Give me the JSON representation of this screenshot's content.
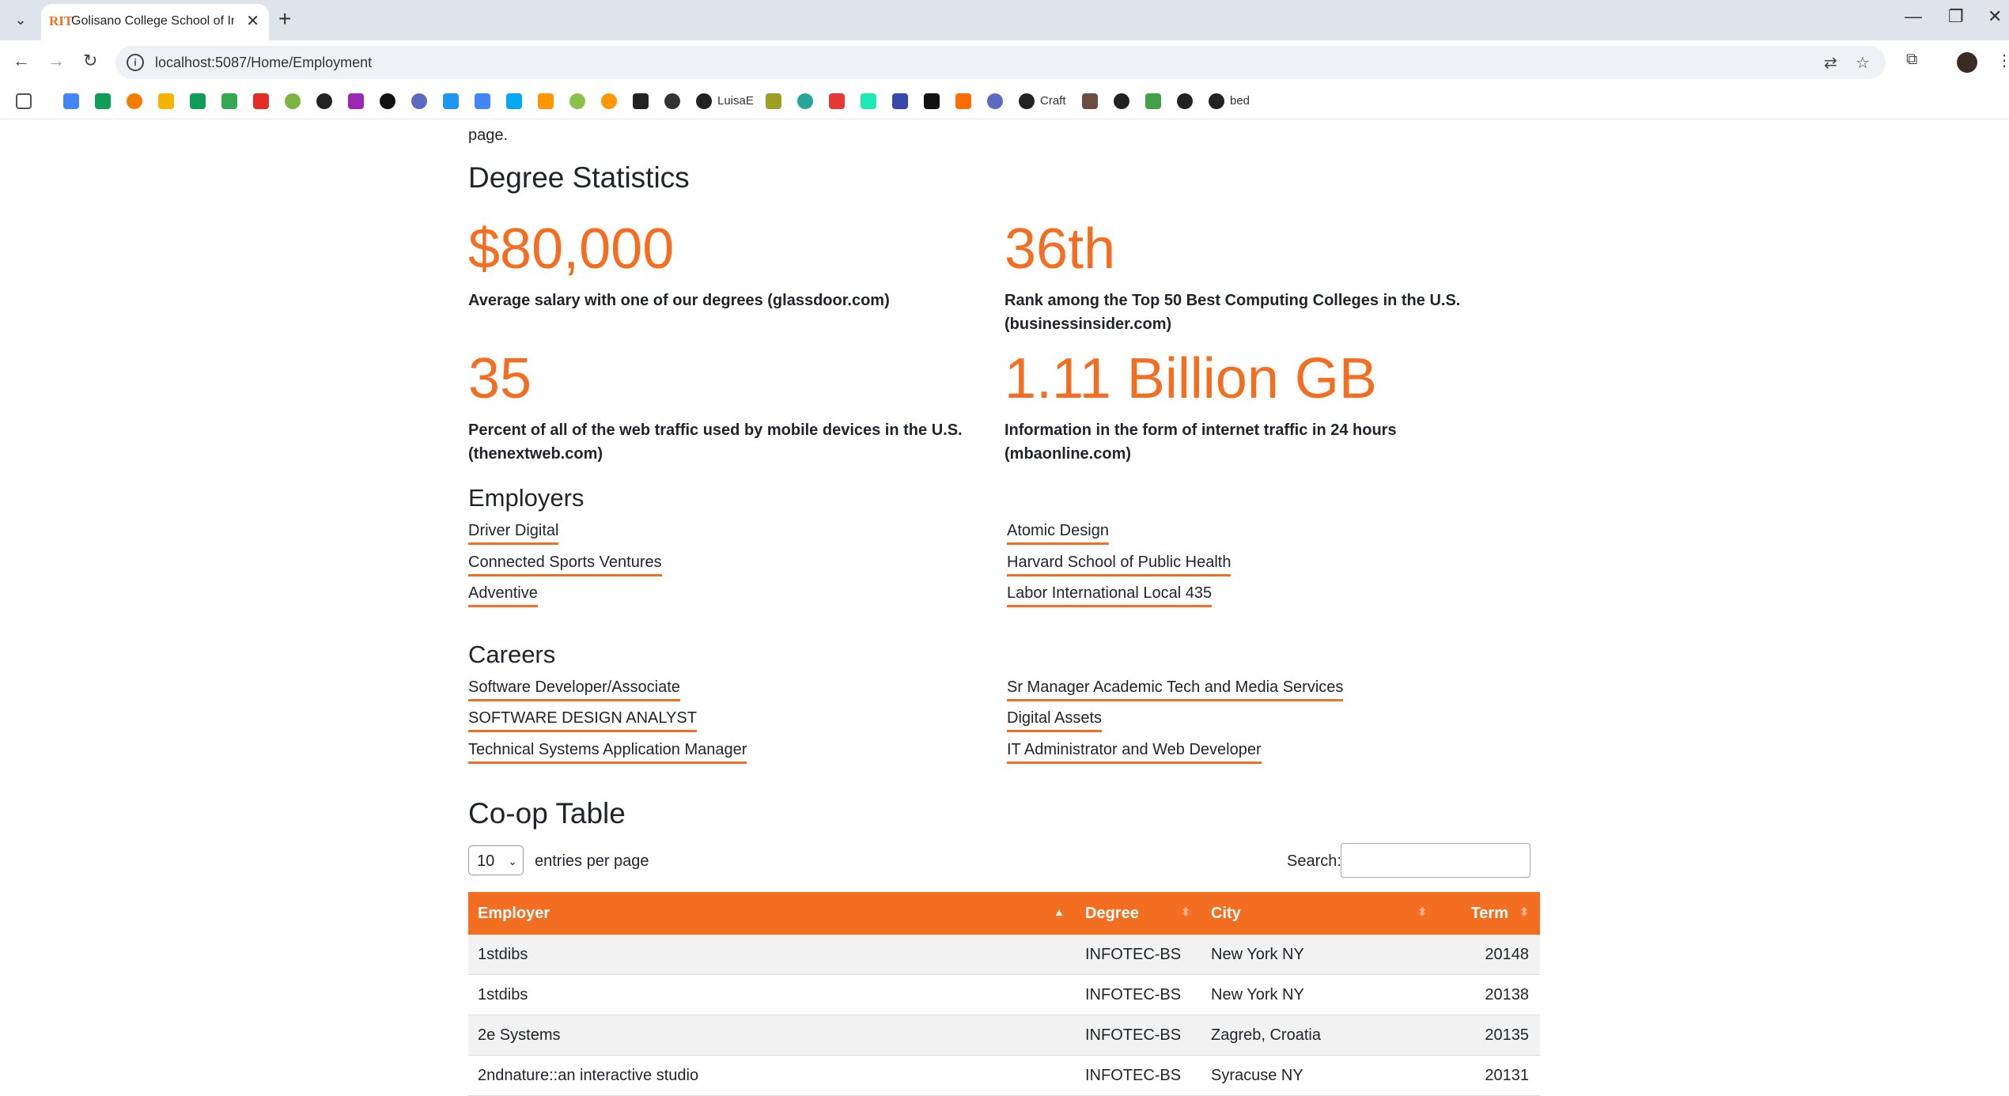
{
  "browser": {
    "tab_title": "Golisano College School of Information",
    "tab_favicon": "RIT",
    "url": "localhost:5087/Home/Employment",
    "bookmarks": [
      "LuisaE",
      "Craft",
      "bed"
    ]
  },
  "page": {
    "intro_tail": "page.",
    "degree_statistics": {
      "title": "Degree Statistics",
      "stats": [
        {
          "value": "$80,000",
          "description": "Average salary with one of our degrees (glassdoor.com)"
        },
        {
          "value": "36th",
          "description": "Rank among the Top 50 Best Computing Colleges in the U.S. (businessinsider.com)"
        },
        {
          "value": "35",
          "description": "Percent of all of the web traffic used by mobile devices in the U.S. (thenextweb.com)"
        },
        {
          "value": "1.11 Billion GB",
          "description": "Information in the form of internet traffic in 24 hours (mbaonline.com)"
        }
      ]
    },
    "employers": {
      "title": "Employers",
      "items": [
        "Driver Digital",
        "Atomic Design",
        "Connected Sports Ventures",
        "Harvard School of Public Health",
        "Adventive",
        "Labor International Local 435"
      ]
    },
    "careers": {
      "title": "Careers",
      "items": [
        "Software Developer/Associate",
        "Sr Manager Academic Tech and Media Services",
        "SOFTWARE DESIGN ANALYST",
        "Digital Assets",
        "Technical Systems Application Manager",
        "IT Administrator and Web Developer"
      ]
    },
    "coop": {
      "title": "Co-op Table",
      "page_size": "10",
      "entries_label": "entries per page",
      "search_label": "Search:",
      "columns": [
        "Employer",
        "Degree",
        "City",
        "Term"
      ],
      "rows": [
        [
          "1stdibs",
          "INFOTEC-BS",
          "New York NY",
          "20148"
        ],
        [
          "1stdibs",
          "INFOTEC-BS",
          "New York NY",
          "20138"
        ],
        [
          "2e Systems",
          "INFOTEC-BS",
          "Zagreb, Croatia",
          "20135"
        ],
        [
          "2ndnature::an interactive studio",
          "INFOTEC-BS",
          "Syracuse NY",
          "20131"
        ]
      ]
    }
  },
  "colors": {
    "accent": "#f36e21"
  }
}
